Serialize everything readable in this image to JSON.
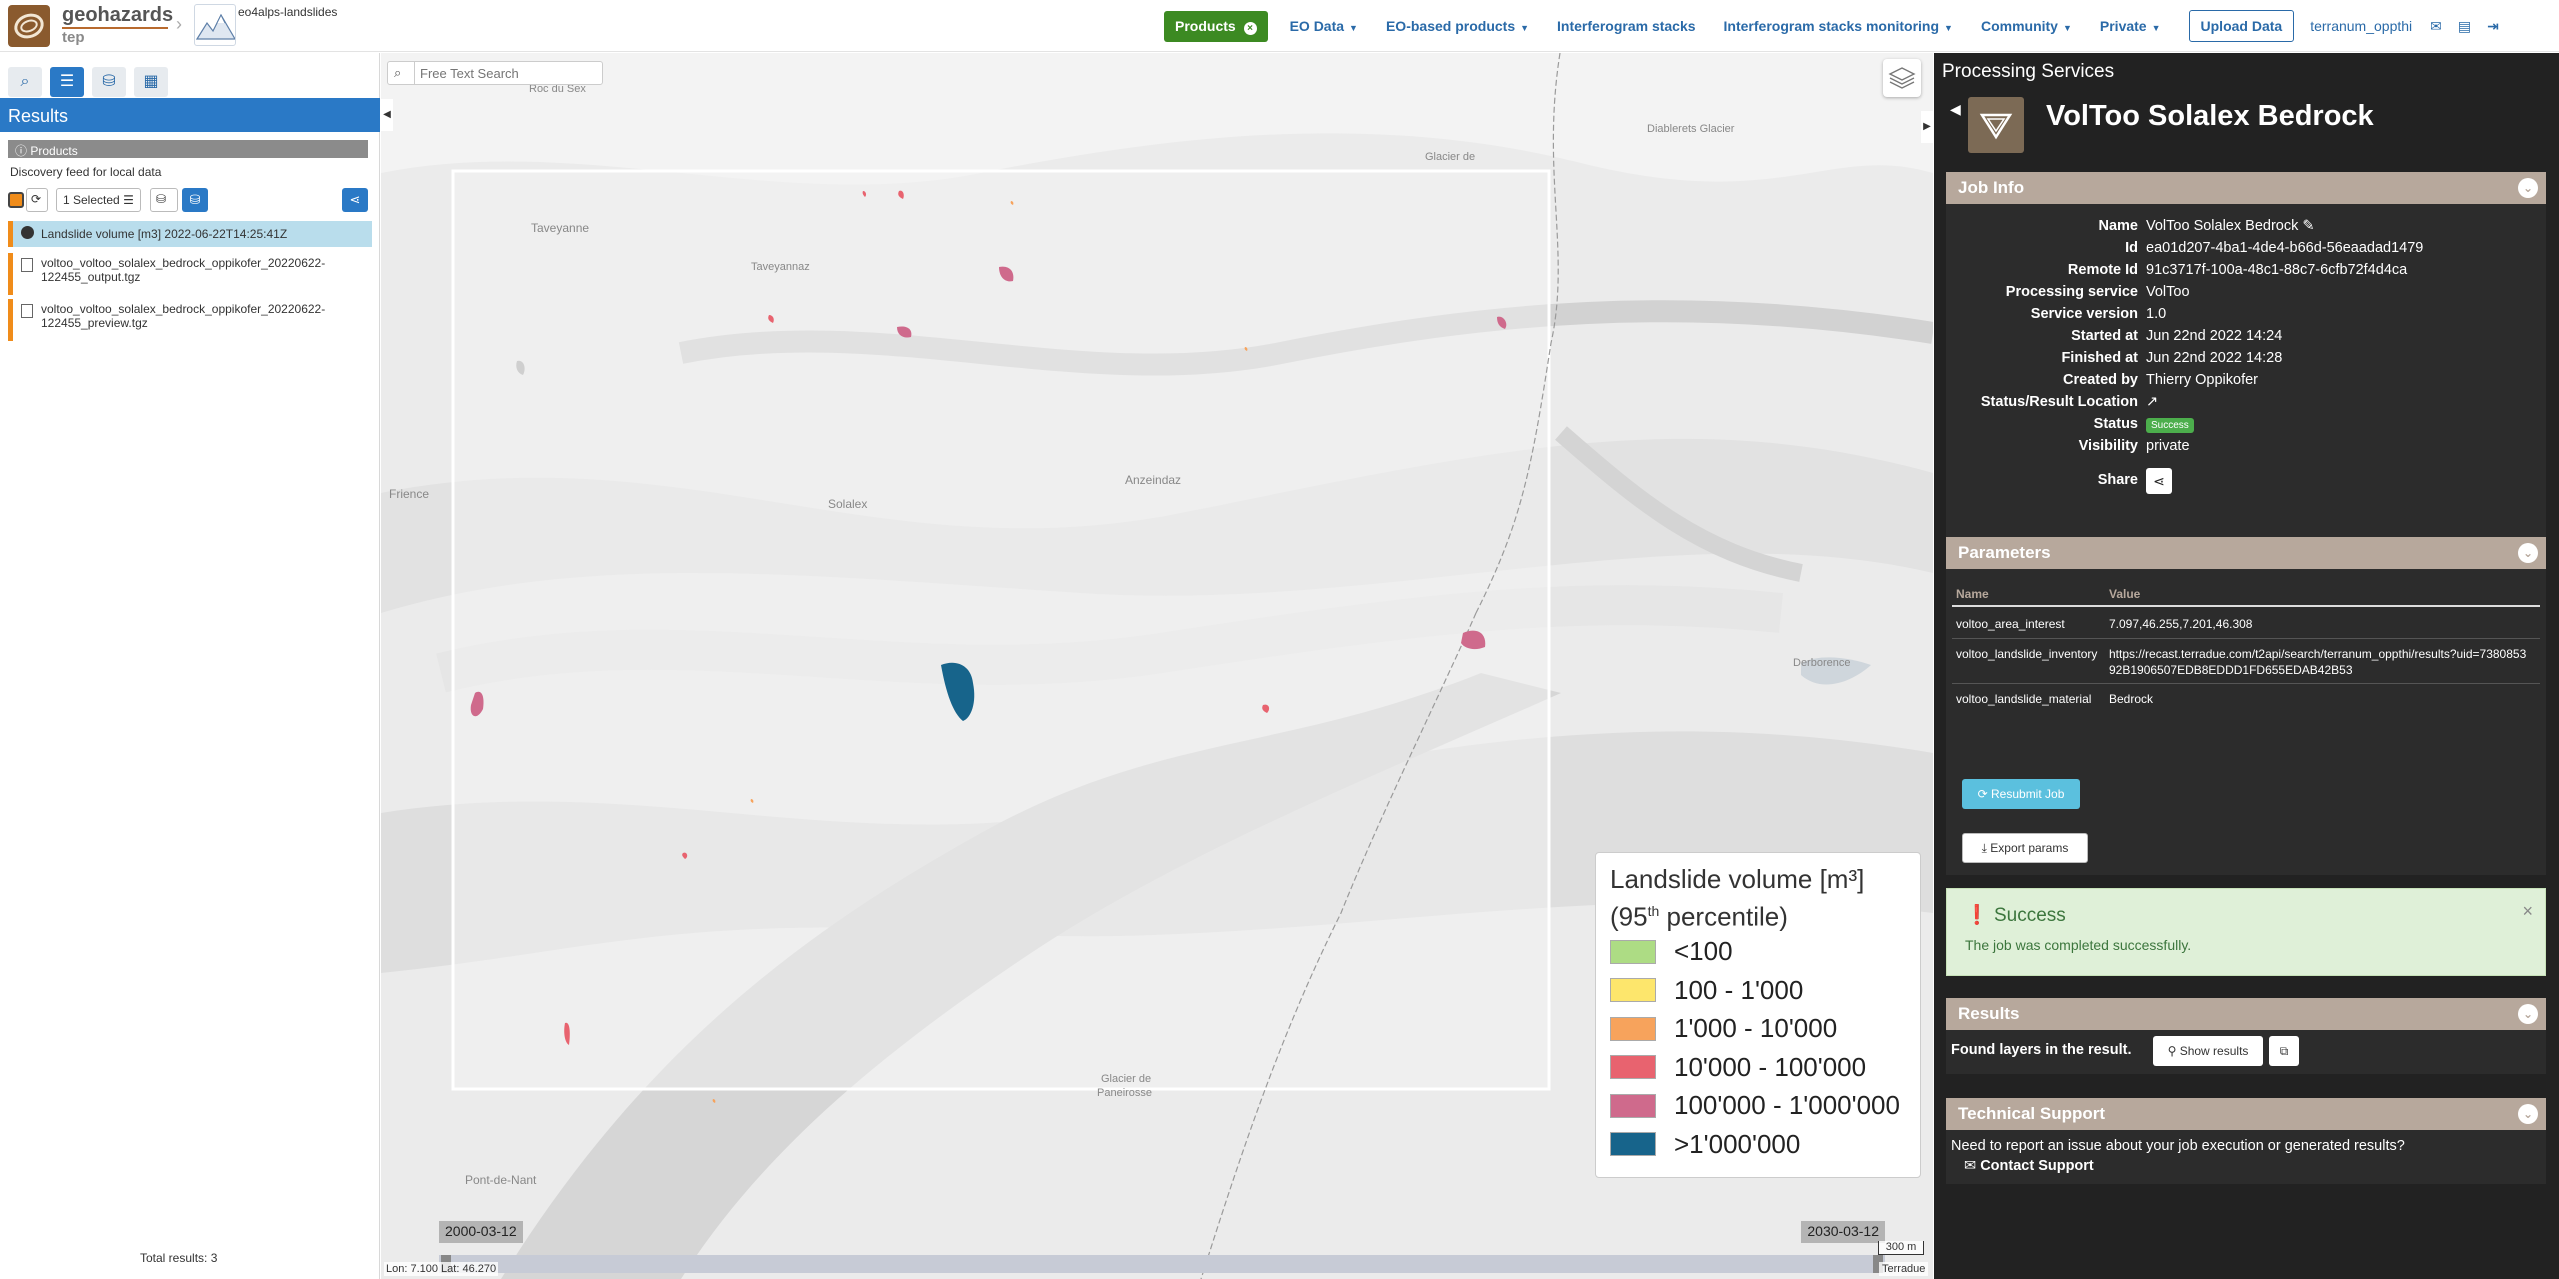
{
  "header": {
    "brand": "geohazards",
    "brand_sub": "tep",
    "community": "eo4alps-landslides",
    "nav": [
      {
        "label": "Products",
        "kind": "products"
      },
      {
        "label": "EO Data",
        "caret": true
      },
      {
        "label": "EO-based products",
        "caret": true
      },
      {
        "label": "Interferogram stacks",
        "caret": false
      },
      {
        "label": "Interferogram stacks monitoring",
        "caret": true
      },
      {
        "label": "Community",
        "caret": true
      },
      {
        "label": "Private",
        "caret": true
      }
    ],
    "upload": "Upload Data",
    "user": "terranum_oppthi",
    "icons": [
      "envelope-icon",
      "book-icon",
      "logout-icon"
    ]
  },
  "left": {
    "tab_icons": [
      "search-icon",
      "list-icon",
      "basket-icon",
      "archive-icon"
    ],
    "results_title": "Results",
    "products_label": "Products",
    "discovery": "Discovery feed for local data",
    "selected_label": "1 Selected",
    "items": [
      "Landslide volume [m3] 2022-06-22T14:25:41Z",
      "voltoo_voltoo_solalex_bedrock_oppikofer_20220622-122455_output.tgz",
      "voltoo_voltoo_solalex_bedrock_oppikofer_20220622-122455_preview.tgz"
    ],
    "total": "Total results: 3"
  },
  "map": {
    "search_placeholder": "Free Text Search",
    "labels": [
      "Taveyanne",
      "Taveyannaz",
      "Frience",
      "Solalex",
      "Anzeindaz",
      "Glacier de",
      "Diablerets Glacier",
      "Derborence",
      "Glacier de",
      "Paneirosse",
      "Pont-de-Nant",
      "Roc du Sex"
    ],
    "legend": {
      "title_line1": "Landslide volume [m³]",
      "title_line2_pre": "(95",
      "title_sup": "th",
      "title_line2_post": " percentile)",
      "classes": [
        {
          "label": "<100",
          "color": "#addc84"
        },
        {
          "label": "100 - 1'000",
          "color": "#fde66c"
        },
        {
          "label": "1'000 - 10'000",
          "color": "#f7a35c"
        },
        {
          "label": "10'000 - 100'000",
          "color": "#e8636f"
        },
        {
          "label": "100'000 - 1'000'000",
          "color": "#cf6a8c"
        },
        {
          "label": ">1'000'000",
          "color": "#17648b"
        }
      ]
    },
    "date_start": "2000-03-12",
    "date_end": "2030-03-12",
    "scale": "300 m",
    "coords": "Lon: 7.100 Lat: 46.270",
    "attribution": "Terradue"
  },
  "right": {
    "panel_title": "Processing Services",
    "service_title": "VolToo Solalex Bedrock",
    "job_info_title": "Job Info",
    "job_info": [
      {
        "k": "Name",
        "v": "VolToo Solalex Bedrock"
      },
      {
        "k": "Id",
        "v": "ea01d207-4ba1-4de4-b66d-56eaadad1479"
      },
      {
        "k": "Remote Id",
        "v": "91c3717f-100a-48c1-88c7-6cfb72f4d4ca"
      },
      {
        "k": "Processing service",
        "v": "VolToo"
      },
      {
        "k": "Service version",
        "v": "1.0"
      },
      {
        "k": "Started at",
        "v": "Jun 22nd 2022 14:24"
      },
      {
        "k": "Finished at",
        "v": "Jun 22nd 2022 14:28"
      },
      {
        "k": "Created by",
        "v": "Thierry Oppikofer"
      },
      {
        "k": "Status/Result Location",
        "v": "↗"
      },
      {
        "k": "Status",
        "v": "Success"
      },
      {
        "k": "Visibility",
        "v": "private"
      },
      {
        "k": "Share",
        "v": ""
      }
    ],
    "parameters_title": "Parameters",
    "param_headers": {
      "name": "Name",
      "value": "Value"
    },
    "params": [
      {
        "name": "voltoo_area_interest",
        "value": "7.097,46.255,7.201,46.308"
      },
      {
        "name": "voltoo_landslide_inventory",
        "value": "https://recast.terradue.com/t2api/search/terranum_oppthi/results?uid=738085392B1906507EDB8EDDD1FD655EDAB42B53"
      },
      {
        "name": "voltoo_landslide_material",
        "value": "Bedrock"
      }
    ],
    "resubmit": "Resubmit Job",
    "export": "Export params",
    "success_title": "Success",
    "success_msg": "The job was completed successfully.",
    "results_title": "Results",
    "results_label": "Found layers in the result.",
    "show_results": "Show results",
    "support_title": "Technical Support",
    "support_msg": "Need to report an issue about your job execution or generated results?",
    "contact": "Contact Support"
  }
}
